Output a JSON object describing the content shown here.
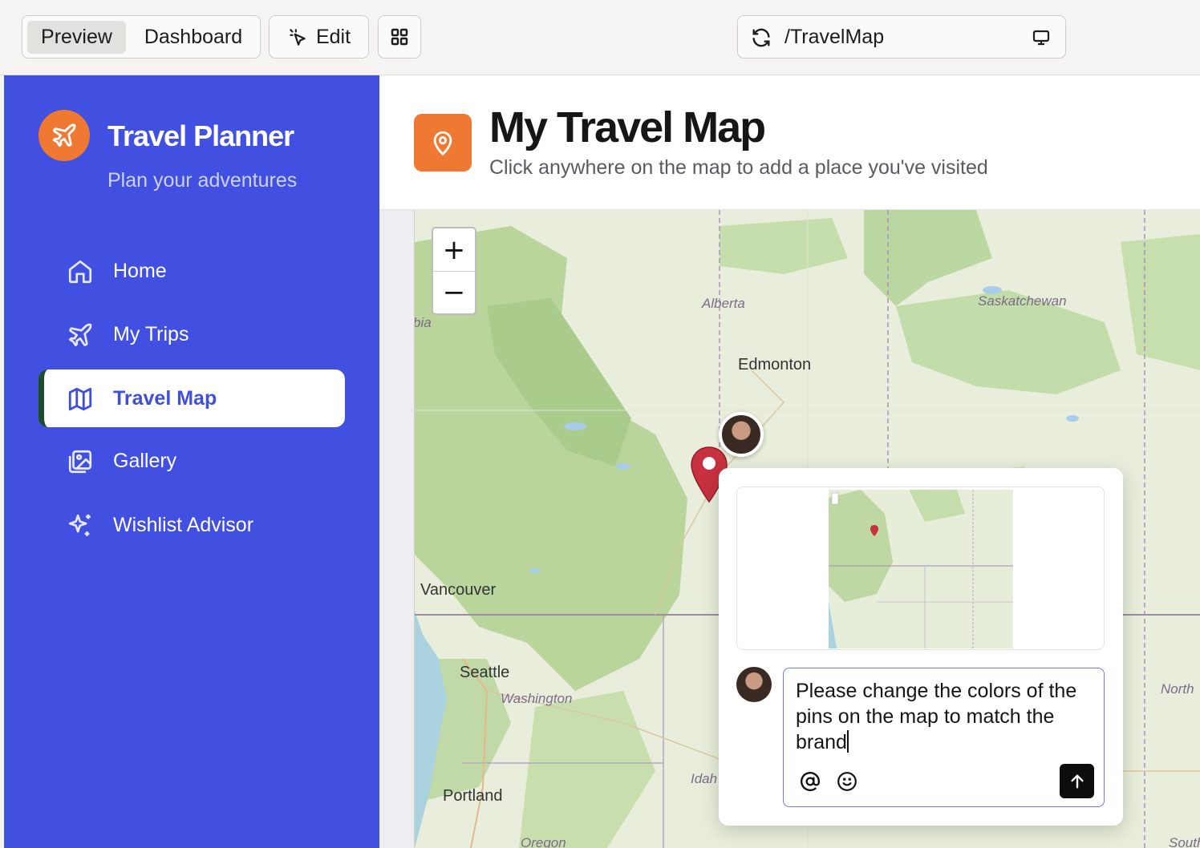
{
  "toolbar": {
    "preview_label": "Preview",
    "dashboard_label": "Dashboard",
    "edit_label": "Edit",
    "url": "/TravelMap"
  },
  "brand": {
    "title": "Travel Planner",
    "subtitle": "Plan your adventures",
    "accent": "#ef7932",
    "sidebar_color": "#4150e0"
  },
  "nav": {
    "items": [
      {
        "label": "Home",
        "icon": "home-icon"
      },
      {
        "label": "My Trips",
        "icon": "plane-icon"
      },
      {
        "label": "Travel Map",
        "icon": "map-icon",
        "active": true
      },
      {
        "label": "Gallery",
        "icon": "gallery-icon"
      },
      {
        "label": "Wishlist Advisor",
        "icon": "sparkles-icon"
      }
    ]
  },
  "page": {
    "title": "My Travel Map",
    "subtitle": "Click anywhere on the map to add a place you've visited"
  },
  "map": {
    "zoom_in": "+",
    "zoom_out": "−",
    "labels": {
      "alberta": "Alberta",
      "saskatchewan": "Saskatchewan",
      "edmonton": "Edmonton",
      "vancouver": "Vancouver",
      "seattle": "Seattle",
      "washington": "Washington",
      "portland": "Portland",
      "oregon": "Oregon",
      "idaho": "Idah",
      "north": "North",
      "south": "South",
      "bia": "bia"
    },
    "pin_color": "#c8313f"
  },
  "comment": {
    "text": "Please change the colors of the pins on the map to match the brand",
    "mention_icon": "at-icon",
    "emoji_icon": "smile-icon",
    "send_icon": "arrow-up-icon"
  }
}
